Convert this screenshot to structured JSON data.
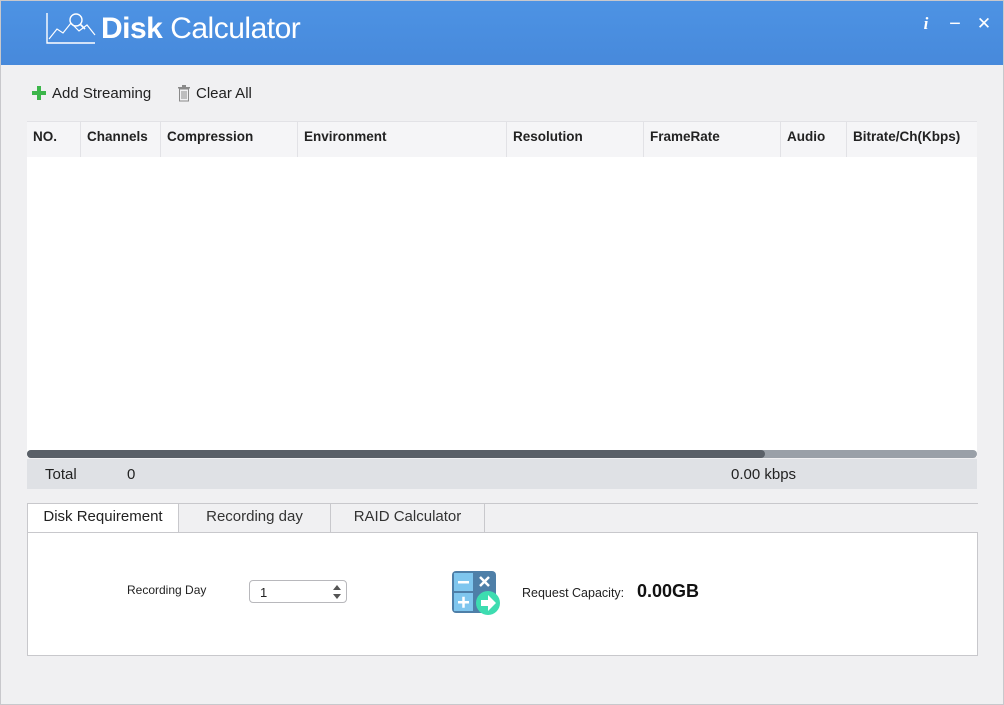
{
  "app": {
    "title_bold": "Disk",
    "title_light": " Calculator"
  },
  "titlebar": {
    "info": "i",
    "minimize": "−",
    "close": "✕"
  },
  "toolbar": {
    "add_label": "Add Streaming",
    "clear_label": "Clear All"
  },
  "table": {
    "columns": [
      "NO.",
      "Channels",
      "Compression",
      "Environment",
      "Resolution",
      "FrameRate",
      "Audio",
      "Bitrate/Ch(Kbps)"
    ],
    "rows": []
  },
  "total": {
    "label": "Total",
    "count": "0",
    "bitrate": "0.00 kbps"
  },
  "tabs": [
    {
      "label": "Disk Requirement",
      "active": true
    },
    {
      "label": "Recording day",
      "active": false
    },
    {
      "label": "RAID Calculator",
      "active": false
    }
  ],
  "disk_requirement": {
    "recording_day_label": "Recording Day",
    "recording_day_value": "1",
    "request_capacity_label": "Request Capacity:",
    "request_capacity_value": "0.00GB"
  },
  "colors": {
    "titlebar": "#4a90e2",
    "accent_green": "#3cb64a"
  }
}
